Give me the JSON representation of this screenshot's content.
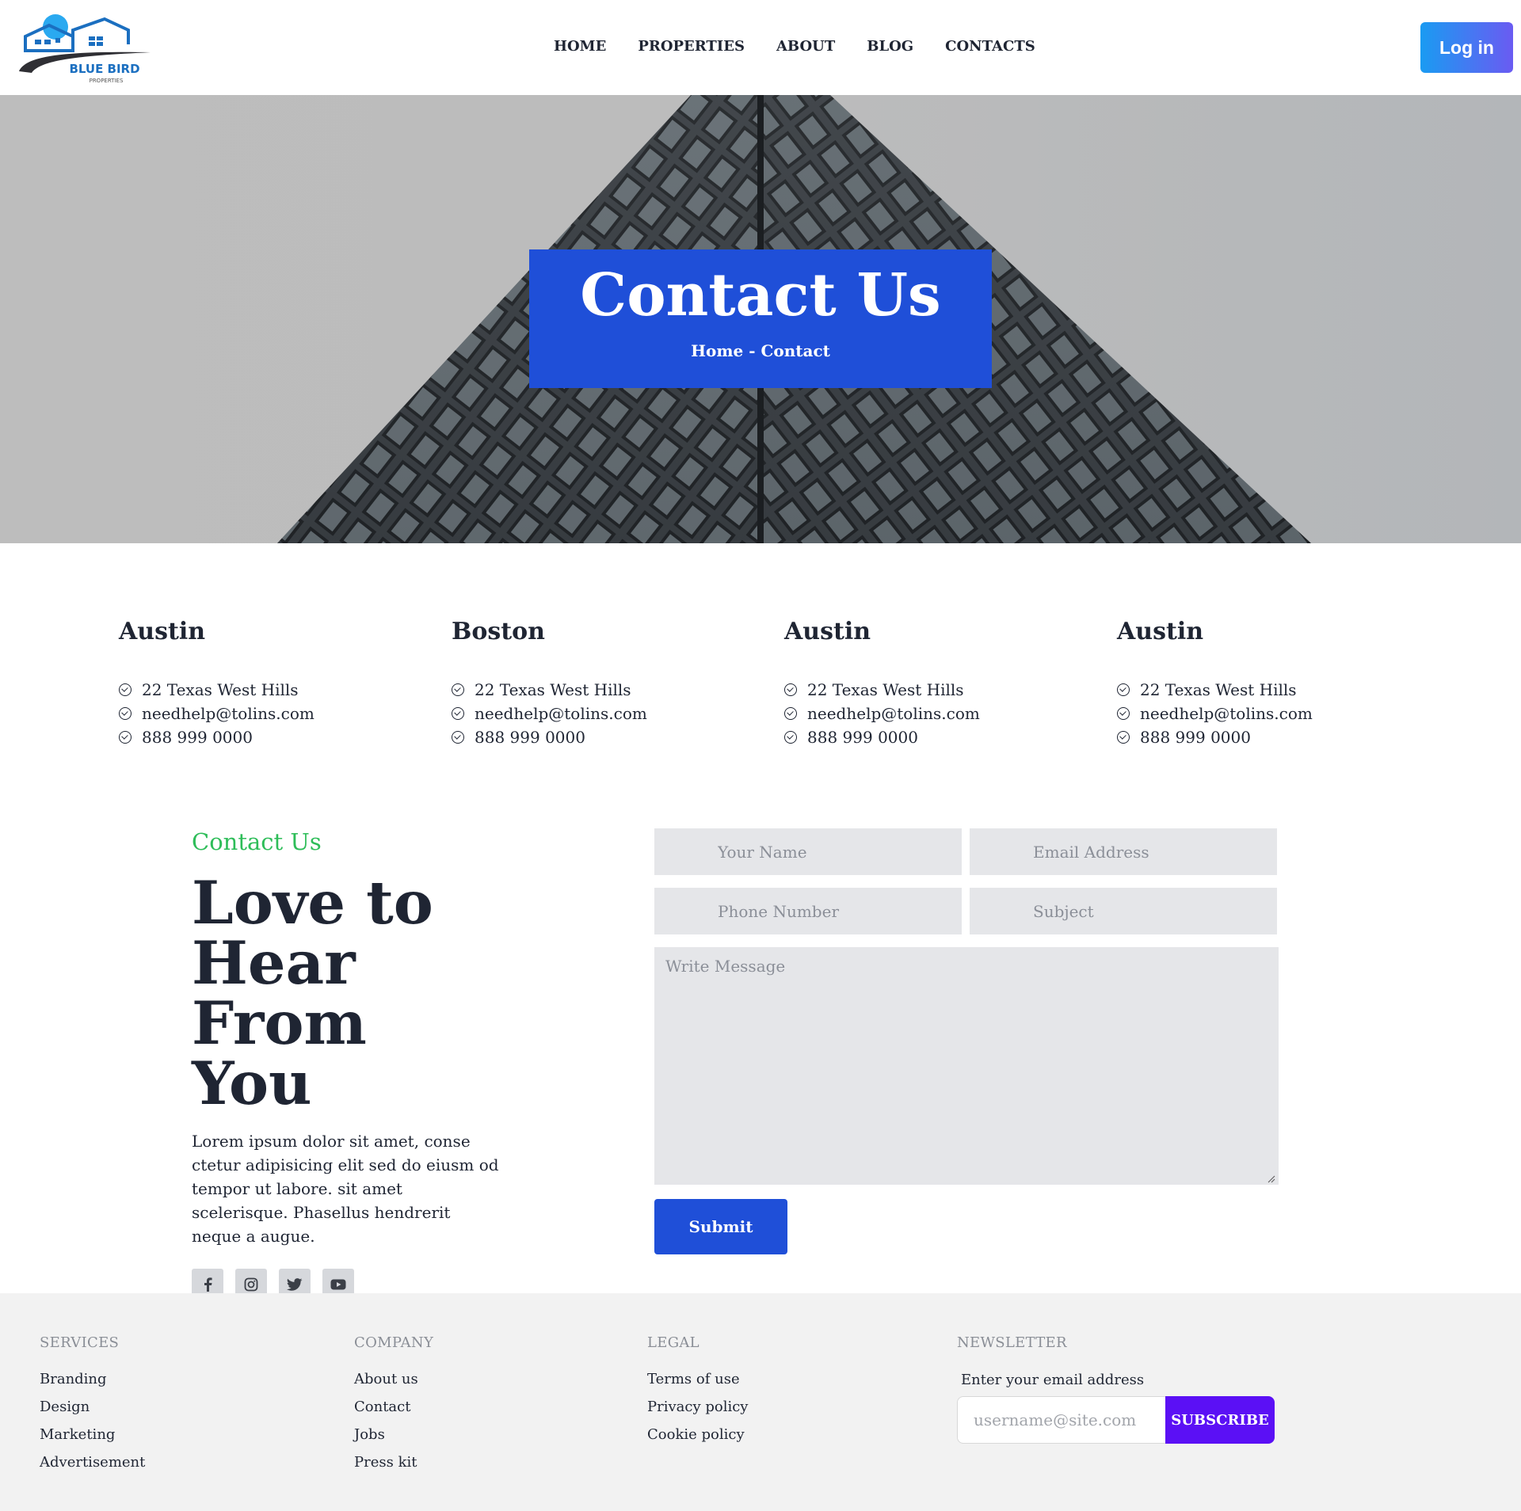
{
  "brand": {
    "name": "BLUE BIRD",
    "tagline": "PROPERTIES",
    "colors": {
      "primary": "#1f4fd8",
      "accent_green": "#2ebd59",
      "subscribe": "#5b10f5",
      "login_gradient_start": "#1a9bf2",
      "login_gradient_end": "#6a5bf2"
    }
  },
  "nav": {
    "items": [
      "HOME",
      "PROPERTIES",
      "ABOUT",
      "BLOG",
      "CONTACTS"
    ],
    "login_label": "Log in"
  },
  "hero": {
    "title": "Contact Us",
    "breadcrumb": "Home - Contact"
  },
  "offices": [
    {
      "city": "Austin",
      "address": "22 Texas West Hills",
      "email": "needhelp@tolins.com",
      "phone": "888 999 0000"
    },
    {
      "city": "Boston",
      "address": "22 Texas West Hills",
      "email": "needhelp@tolins.com",
      "phone": "888 999 0000"
    },
    {
      "city": "Austin",
      "address": "22 Texas West Hills",
      "email": "needhelp@tolins.com",
      "phone": "888 999 0000"
    },
    {
      "city": "Austin",
      "address": "22 Texas West Hills",
      "email": "needhelp@tolins.com",
      "phone": "888 999 0000"
    }
  ],
  "contact": {
    "eyebrow": "Contact Us",
    "heading_line1": "Love to",
    "heading_line2": "Hear From",
    "heading_line3": "You",
    "text": "Lorem ipsum dolor sit amet, conse ctetur adipisicing elit sed do eiusm od tempor ut labore. sit amet scelerisque. Phasellus hendrerit neque a augue.",
    "socials": [
      "facebook-icon",
      "instagram-icon",
      "twitter-icon",
      "youtube-icon"
    ]
  },
  "form": {
    "name_placeholder": "Your Name",
    "email_placeholder": "Email Address",
    "phone_placeholder": "Phone Number",
    "subject_placeholder": "Subject",
    "message_placeholder": "Write Message",
    "submit_label": "Submit"
  },
  "footer": {
    "services": {
      "heading": "SERVICES",
      "links": [
        "Branding",
        "Design",
        "Marketing",
        "Advertisement"
      ]
    },
    "company": {
      "heading": "COMPANY",
      "links": [
        "About us",
        "Contact",
        "Jobs",
        "Press kit"
      ]
    },
    "legal": {
      "heading": "LEGAL",
      "links": [
        "Terms of use",
        "Privacy policy",
        "Cookie policy"
      ]
    },
    "newsletter": {
      "heading": "NEWSLETTER",
      "label": "Enter your email address",
      "placeholder": "username@site.com",
      "button": "SUBSCRIBE"
    }
  }
}
